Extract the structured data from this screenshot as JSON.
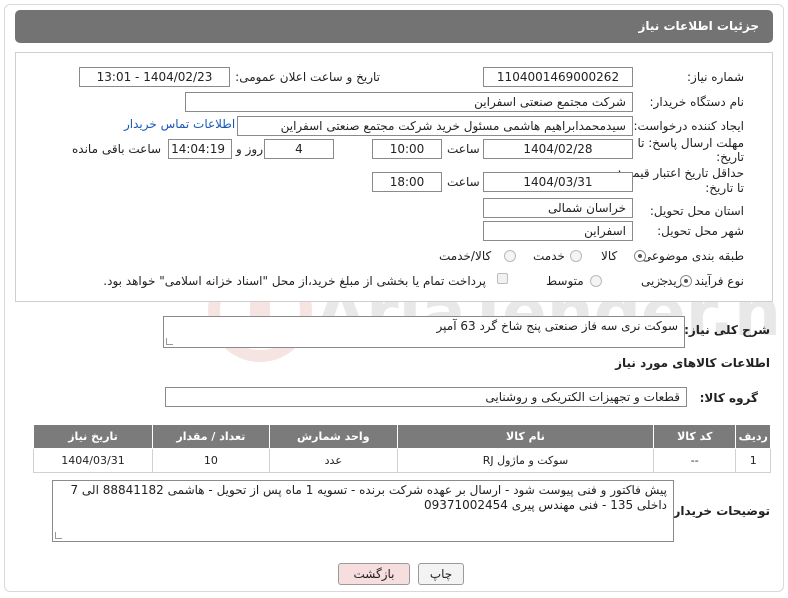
{
  "header": {
    "title": "جزئیات اطلاعات نیاز"
  },
  "form": {
    "need_number": {
      "label": "شماره نیاز:",
      "value": "1104001469000262"
    },
    "announce_datetime": {
      "label": "تاریخ و ساعت اعلان عمومی:",
      "value": "1404/02/23 - 13:01"
    },
    "buyer_org": {
      "label": "نام دستگاه خریدار:",
      "value": "شرکت مجتمع صنعتی اسفراین"
    },
    "requester": {
      "label": "ایجاد کننده درخواست:",
      "value": "سیدمحمدابراهیم هاشمی مسئول خرید شرکت مجتمع صنعتی اسفراین",
      "contact_link": "اطلاعات تماس خریدار"
    },
    "reply_deadline": {
      "label_line1": "مهلت ارسال پاسخ: تا",
      "label_line2": "تاریخ:",
      "date": "1404/02/28",
      "time_label": "ساعت",
      "time": "10:00",
      "days": "4",
      "days_label": "روز و",
      "remaining_time": "14:04:19",
      "remaining_label": "ساعت باقی مانده"
    },
    "price_validity": {
      "label_line1": "حداقل تاریخ اعتبار قیمت:",
      "label_line2": "تا تاریخ:",
      "date": "1404/03/31",
      "time_label": "ساعت",
      "time": "18:00"
    },
    "delivery_province": {
      "label": "استان محل تحویل:",
      "value": "خراسان شمالی"
    },
    "delivery_city": {
      "label": "شهر محل تحویل:",
      "value": "اسفراین"
    },
    "category": {
      "label": "طبقه بندی موضوعی:",
      "options": [
        {
          "label": "کالا",
          "selected": true
        },
        {
          "label": "خدمت",
          "selected": false
        },
        {
          "label": "کالا/خدمت",
          "selected": false
        }
      ]
    },
    "purchase_type": {
      "label": "نوع فرآیند خرید :",
      "options": [
        {
          "label": "جزیی",
          "selected": true
        },
        {
          "label": "متوسط",
          "selected": false
        }
      ],
      "payment_note": "پرداخت تمام یا بخشی از مبلغ خرید،از محل \"اسناد خزانه اسلامی\" خواهد بود."
    }
  },
  "summary": {
    "label": "شرح کلی نیاز:",
    "value": "سوکت نری سه فاز صنعتی پنج شاخ گرد 63 آمپر"
  },
  "goods_section": {
    "title": "اطلاعات کالاهای مورد نیاز"
  },
  "goods_group": {
    "label": "گروه کالا:",
    "value": "قطعات و تجهیزات الکتریکی و روشنایی"
  },
  "table": {
    "headers": [
      "ردیف",
      "کد کالا",
      "نام کالا",
      "واحد شمارش",
      "تعداد / مقدار",
      "تاریخ نیاز"
    ],
    "rows": [
      [
        "1",
        "--",
        "سوکت و ماژول RJ",
        "عدد",
        "10",
        "1404/03/31"
      ]
    ]
  },
  "buyer_notes": {
    "label": "توضیحات خریدار:",
    "line1": "پیش فاکتور و فنی پیوست شود - ارسال بر عهده شرکت برنده - تسویه 1 ماه پس از تحویل - هاشمی 88841182 الی 7",
    "line2": "داخلی 135 - فنی مهندس پیری 09371002454"
  },
  "buttons": {
    "print": "چاپ",
    "back": "بازگشت"
  },
  "watermark": {
    "text": "AriaTender.neT"
  },
  "colors": {
    "header_bg": "#737373",
    "link": "#1a58b8",
    "back_button_bg": "#f7dede"
  }
}
